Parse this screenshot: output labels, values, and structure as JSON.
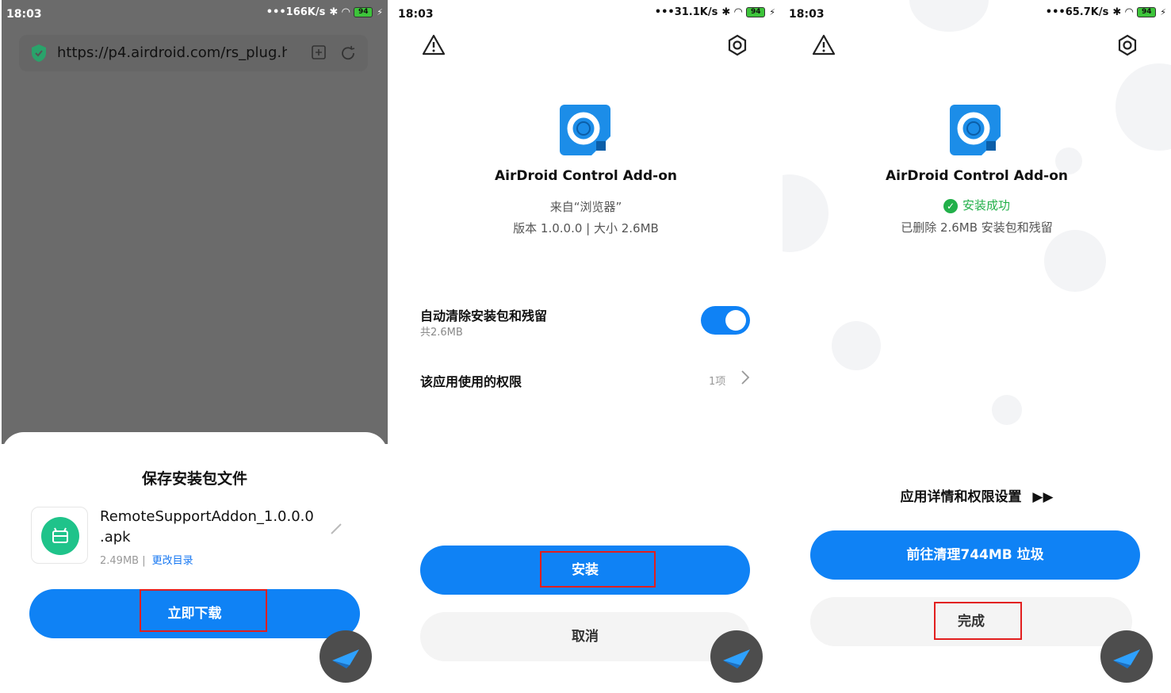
{
  "panel1": {
    "status": {
      "time": "18:03",
      "speed": "166K/s",
      "battery": "94"
    },
    "browser": {
      "url": "https://p4.airdroid.com/rs_plug.h"
    },
    "sheet": {
      "title": "保存安装包文件",
      "file_name": "RemoteSupportAddon_1.0.0.0 .apk",
      "file_size": "2.49MB |",
      "change_dir": "更改目录",
      "download_button": "立即下载"
    }
  },
  "panel2": {
    "status": {
      "time": "18:03",
      "speed": "31.1K/s",
      "battery": "94"
    },
    "app_name": "AirDroid Control Add-on",
    "source": "来自“浏览器”",
    "version_size": "版本 1.0.0.0 | 大小 2.6MB",
    "auto_clean": {
      "title": "自动清除安装包和残留",
      "subtitle": "共2.6MB",
      "enabled": true
    },
    "permissions": {
      "title": "该应用使用的权限",
      "count": "1项"
    },
    "install_button": "安装",
    "cancel_button": "取消"
  },
  "panel3": {
    "status": {
      "time": "18:03",
      "speed": "65.7K/s",
      "battery": "94"
    },
    "app_name": "AirDroid Control Add-on",
    "success_text": "安装成功",
    "deleted_text": "已删除 2.6MB 安装包和残留",
    "details_link": "应用详情和权限设置",
    "clean_button": "前往清理744MB 垃圾",
    "done_button": "完成"
  },
  "colors": {
    "accent": "#0f82f5",
    "success": "#22b04a",
    "highlight": "#e21e1e",
    "overlay": "#6b6b6b"
  }
}
